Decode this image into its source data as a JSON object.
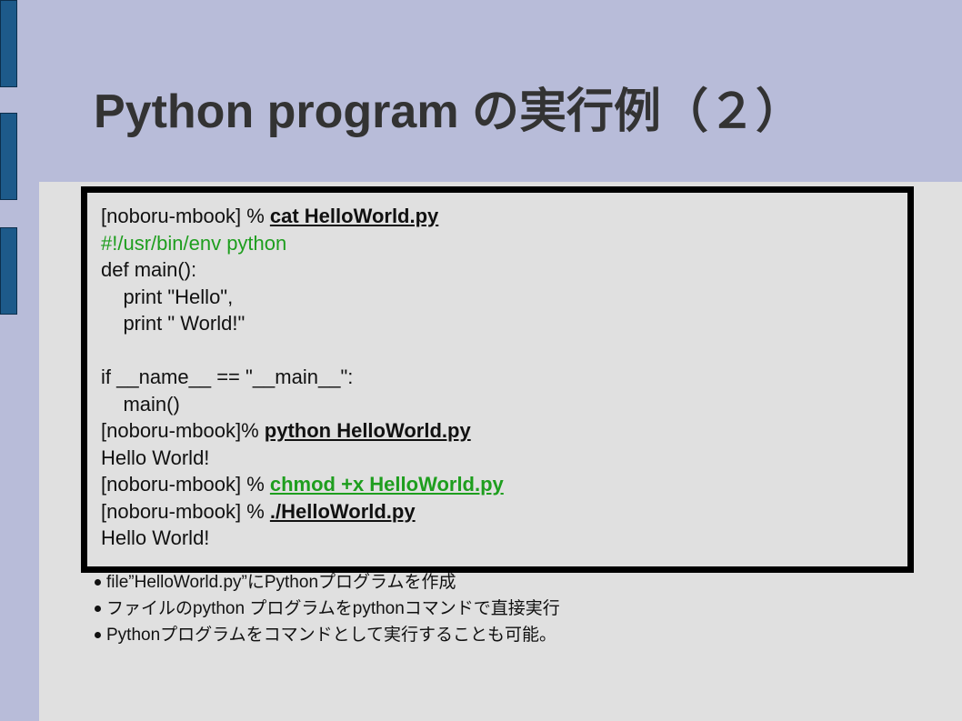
{
  "slide": {
    "title": "Python program の実行例（２）",
    "code_lines": [
      {
        "prefix": "[noboru-mbook] % ",
        "command": "cat HelloWorld.py"
      },
      {
        "text": "#!/usr/bin/env python"
      },
      {
        "text": "def main():"
      },
      {
        "text": "    print \"Hello\","
      },
      {
        "text": "    print \" World!\""
      },
      {
        "text": ""
      },
      {
        "text": "if __name__ == \"__main__\":"
      },
      {
        "text": "    main()"
      },
      {
        "prefix": "[noboru-mbook]% ",
        "command": "python HelloWorld.py"
      },
      {
        "text": "Hello World!"
      },
      {
        "prefix": "[noboru-mbook] % ",
        "command": "chmod +x HelloWorld.py"
      },
      {
        "prefix": "[noboru-mbook] % ",
        "command": "./HelloWorld.py"
      },
      {
        "text": "Hello World!"
      }
    ],
    "bullets": [
      "file”HelloWorld.py”にPythonプログラムを作成",
      "ファイルのpython プログラムをpythonコマンドで直接実行",
      "Pythonプログラムをコマンドとして実行することも可能。"
    ],
    "colors": {
      "header_band": "#b8bcd9",
      "side_bars": "#1d5a8a",
      "code_green": "#1e9e1e",
      "background": "#e0e0e0"
    }
  }
}
